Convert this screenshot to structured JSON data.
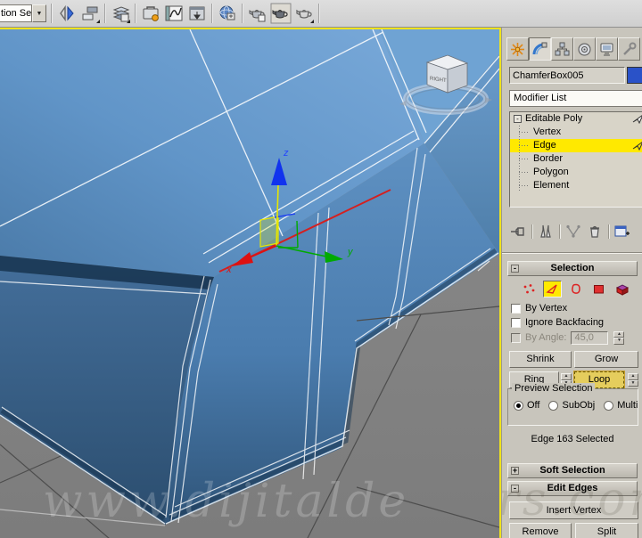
{
  "toolbar": {
    "selection_set_value": "tion Se",
    "icons": [
      "mirror",
      "align",
      "layer-manager",
      "graphite-modeling",
      "curve-editor",
      "schematic-view",
      "material-editor",
      "render-setup",
      "rendered-frame-window",
      "render-production"
    ]
  },
  "viewport": {
    "watermark_left": "www.dijitalde",
    "watermark_right": "rs.com",
    "viewcube_label": "RIGHT",
    "axis_labels": {
      "x": "x",
      "y": "y",
      "z": "z"
    }
  },
  "command_panel": {
    "tabs": [
      "create",
      "modify",
      "hierarchy",
      "motion",
      "display",
      "utilities"
    ],
    "active_tab": "modify",
    "object_name": "ChamferBox005",
    "modifier_list_label": "Modifier List",
    "modifier_stack": {
      "root_label": "Editable Poly",
      "items": [
        "Vertex",
        "Edge",
        "Border",
        "Polygon",
        "Element"
      ],
      "selected_item": "Edge",
      "collapse_glyph": "-"
    },
    "stack_tools": [
      "pin-stack",
      "show-end-result",
      "make-unique",
      "remove-modifier",
      "configure-modifier-sets"
    ],
    "selection_rollout": {
      "state": "-",
      "title": "Selection",
      "by_vertex_label": "By Vertex",
      "ignore_backfacing_label": "Ignore Backfacing",
      "by_angle_label": "By Angle:",
      "by_angle_value": "45,0",
      "shrink_label": "Shrink",
      "grow_label": "Grow",
      "ring_label": "Ring",
      "loop_label": "Loop",
      "preview_title": "Preview Selection",
      "preview_options": [
        "Off",
        "SubObj",
        "Multi"
      ],
      "preview_selected": "Off",
      "status_text": "Edge 163 Selected"
    },
    "soft_selection": {
      "state": "+",
      "title": "Soft Selection"
    },
    "edit_edges": {
      "state": "-",
      "title": "Edit Edges",
      "insert_vertex_label": "Insert Vertex",
      "remove_label": "Remove",
      "split_label": "Split"
    }
  },
  "colors": {
    "active_viewport_border": "#efe31d",
    "selected_edge": "#d42020",
    "subobject_highlight": "#ffe900",
    "object_color_swatch": "#2a52c8",
    "ground": "#848484",
    "box_blue": "#5b8cbf"
  }
}
